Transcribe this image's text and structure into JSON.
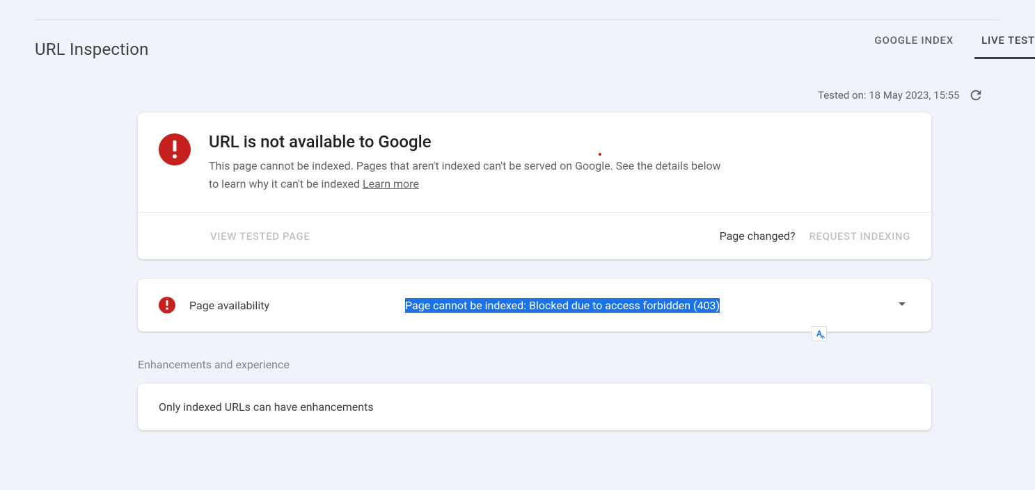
{
  "header": {
    "title": "URL Inspection",
    "tabs": {
      "google_index": "GOOGLE INDEX",
      "live_test": "LIVE TEST"
    }
  },
  "tested": {
    "label": "Tested on: 18 May 2023, 15:55"
  },
  "status": {
    "title": "URL is not available to Google",
    "desc_part1": "This page cannot be indexed. Pages that aren't indexed can't be served on Google. See the details below to learn why it can't be indexed ",
    "learn_more": "Learn more"
  },
  "actions": {
    "view_tested": "VIEW TESTED PAGE",
    "page_changed": "Page changed?",
    "request_indexing": "REQUEST INDEXING"
  },
  "availability": {
    "label": "Page availability",
    "status": "Page cannot be indexed: Blocked due to access forbidden (403)"
  },
  "enhancements": {
    "section_label": "Enhancements and experience",
    "message": "Only indexed URLs can have enhancements"
  },
  "icons": {
    "translate": "A"
  }
}
